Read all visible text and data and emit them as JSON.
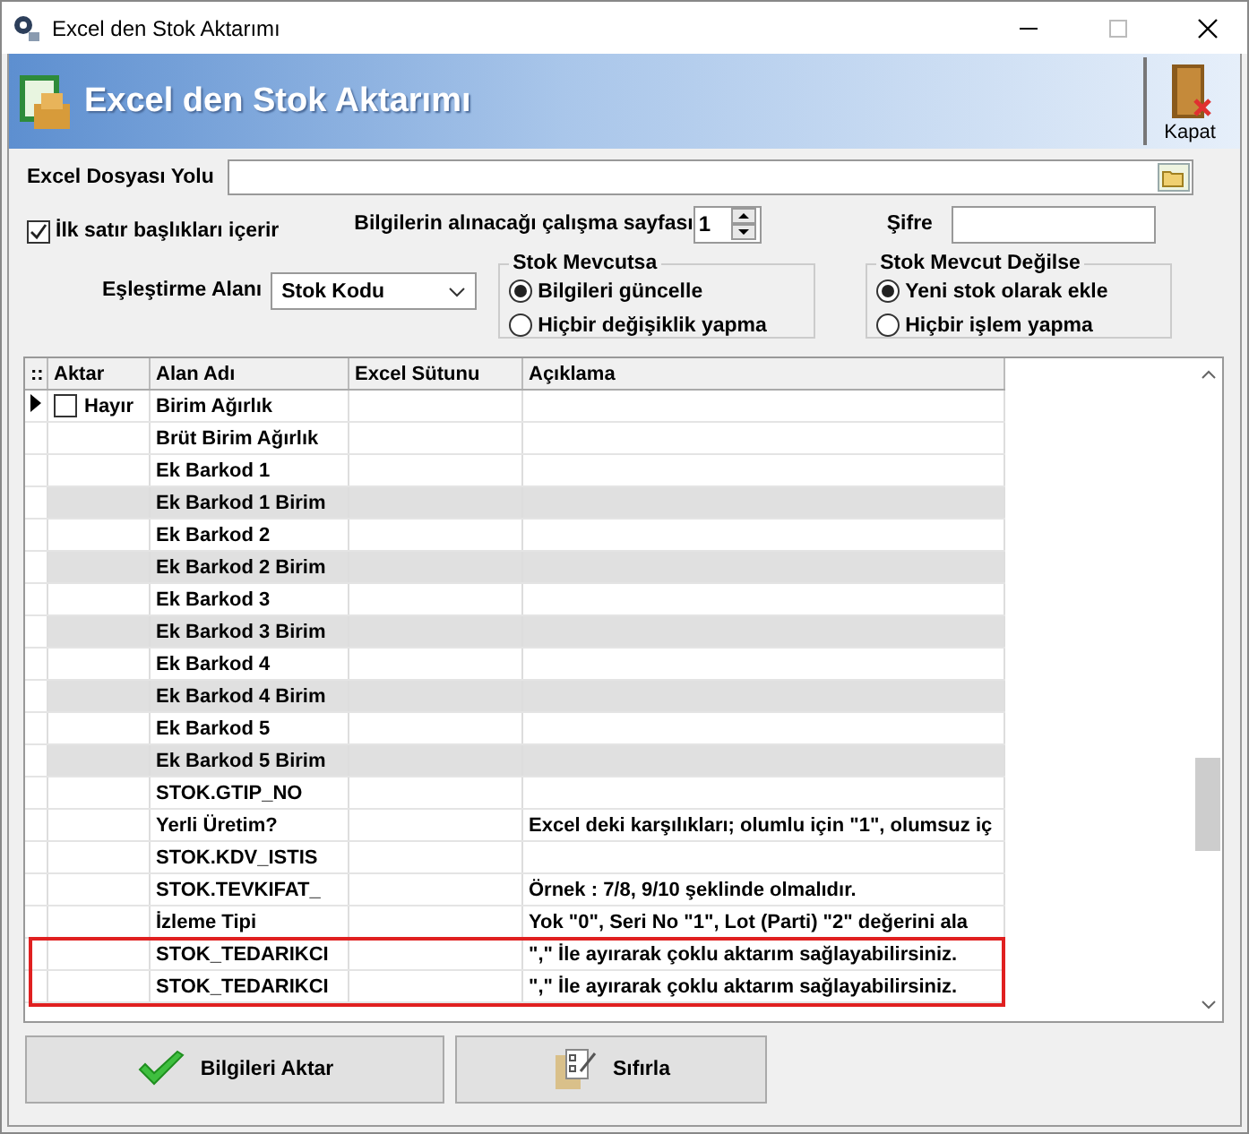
{
  "window": {
    "title": "Excel den Stok Aktarımı"
  },
  "header": {
    "title": "Excel den Stok Aktarımı",
    "close_label": "Kapat"
  },
  "form": {
    "file_label": "Excel Dosyası Yolu",
    "header_checkbox": {
      "label": "İlk satır başlıkları içerir",
      "checked": true
    },
    "sheet_label": "Bilgilerin alınacağı çalışma sayfası",
    "sheet_value": "1",
    "password_label": "Şifre",
    "match_label": "Eşleştirme Alanı",
    "match_value": "Stok Kodu",
    "groups": [
      {
        "title": "Stok Mevcutsa",
        "options": [
          {
            "label": "Bilgileri güncelle",
            "selected": true
          },
          {
            "label": "Hiçbir değişiklik yapma",
            "selected": false
          }
        ]
      },
      {
        "title": "Stok Mevcut Değilse",
        "options": [
          {
            "label": "Yeni stok olarak ekle",
            "selected": true
          },
          {
            "label": "Hiçbir işlem yapma",
            "selected": false
          }
        ]
      }
    ]
  },
  "table": {
    "indicator": "::",
    "columns": [
      "Aktar",
      "Alan Adı",
      "Excel Sütunu",
      "Açıklama"
    ],
    "rows": [
      {
        "current": true,
        "aktar": {
          "checked": false,
          "label": "Hayır"
        },
        "name": "Birim Ağırlık",
        "shaded": false,
        "highlighted": false
      },
      {
        "current": false,
        "name": "Brüt Birim Ağırlık",
        "shaded": false,
        "highlighted": false
      },
      {
        "current": false,
        "name": "Ek Barkod 1",
        "shaded": false,
        "highlighted": false
      },
      {
        "current": false,
        "name": "Ek Barkod 1 Birim",
        "shaded": true,
        "highlighted": false
      },
      {
        "current": false,
        "name": "Ek Barkod 2",
        "shaded": false,
        "highlighted": false
      },
      {
        "current": false,
        "name": "Ek Barkod 2 Birim",
        "shaded": true,
        "highlighted": false
      },
      {
        "current": false,
        "name": "Ek Barkod 3",
        "shaded": false,
        "highlighted": false
      },
      {
        "current": false,
        "name": "Ek Barkod 3 Birim",
        "shaded": true,
        "highlighted": false
      },
      {
        "current": false,
        "name": "Ek Barkod 4",
        "shaded": false,
        "highlighted": false
      },
      {
        "current": false,
        "name": "Ek Barkod 4 Birim",
        "shaded": true,
        "highlighted": false
      },
      {
        "current": false,
        "name": "Ek Barkod 5",
        "shaded": false,
        "highlighted": false
      },
      {
        "current": false,
        "name": "Ek Barkod 5 Birim",
        "shaded": true,
        "highlighted": false
      },
      {
        "current": false,
        "name": "STOK.GTIP_NO",
        "shaded": false,
        "highlighted": false
      },
      {
        "current": false,
        "name": "Yerli Üretim?",
        "note": "Excel deki karşılıkları; olumlu için \"1\", olumsuz iç",
        "shaded": false,
        "highlighted": false
      },
      {
        "current": false,
        "name": "STOK.KDV_ISTIS",
        "shaded": false,
        "highlighted": false
      },
      {
        "current": false,
        "name": "STOK.TEVKIFAT_",
        "note": "Örnek : 7/8, 9/10 şeklinde olmalıdır.",
        "shaded": false,
        "highlighted": false
      },
      {
        "current": false,
        "name": "İzleme Tipi",
        "note": "Yok \"0\", Seri No \"1\", Lot (Parti) \"2\"  değerini ala",
        "shaded": false,
        "highlighted": false
      },
      {
        "current": false,
        "name": "STOK_TEDARIKCI",
        "note": "\",\" İle ayırarak çoklu aktarım sağlayabilirsiniz.",
        "shaded": false,
        "highlighted": true
      },
      {
        "current": false,
        "name": "STOK_TEDARIKCI",
        "note": "\",\" İle ayırarak çoklu aktarım sağlayabilirsiniz.",
        "shaded": false,
        "highlighted": true
      }
    ]
  },
  "buttons": [
    {
      "kind": "import",
      "label": "Bilgileri Aktar"
    },
    {
      "kind": "reset",
      "label": "Sıfırla"
    }
  ]
}
